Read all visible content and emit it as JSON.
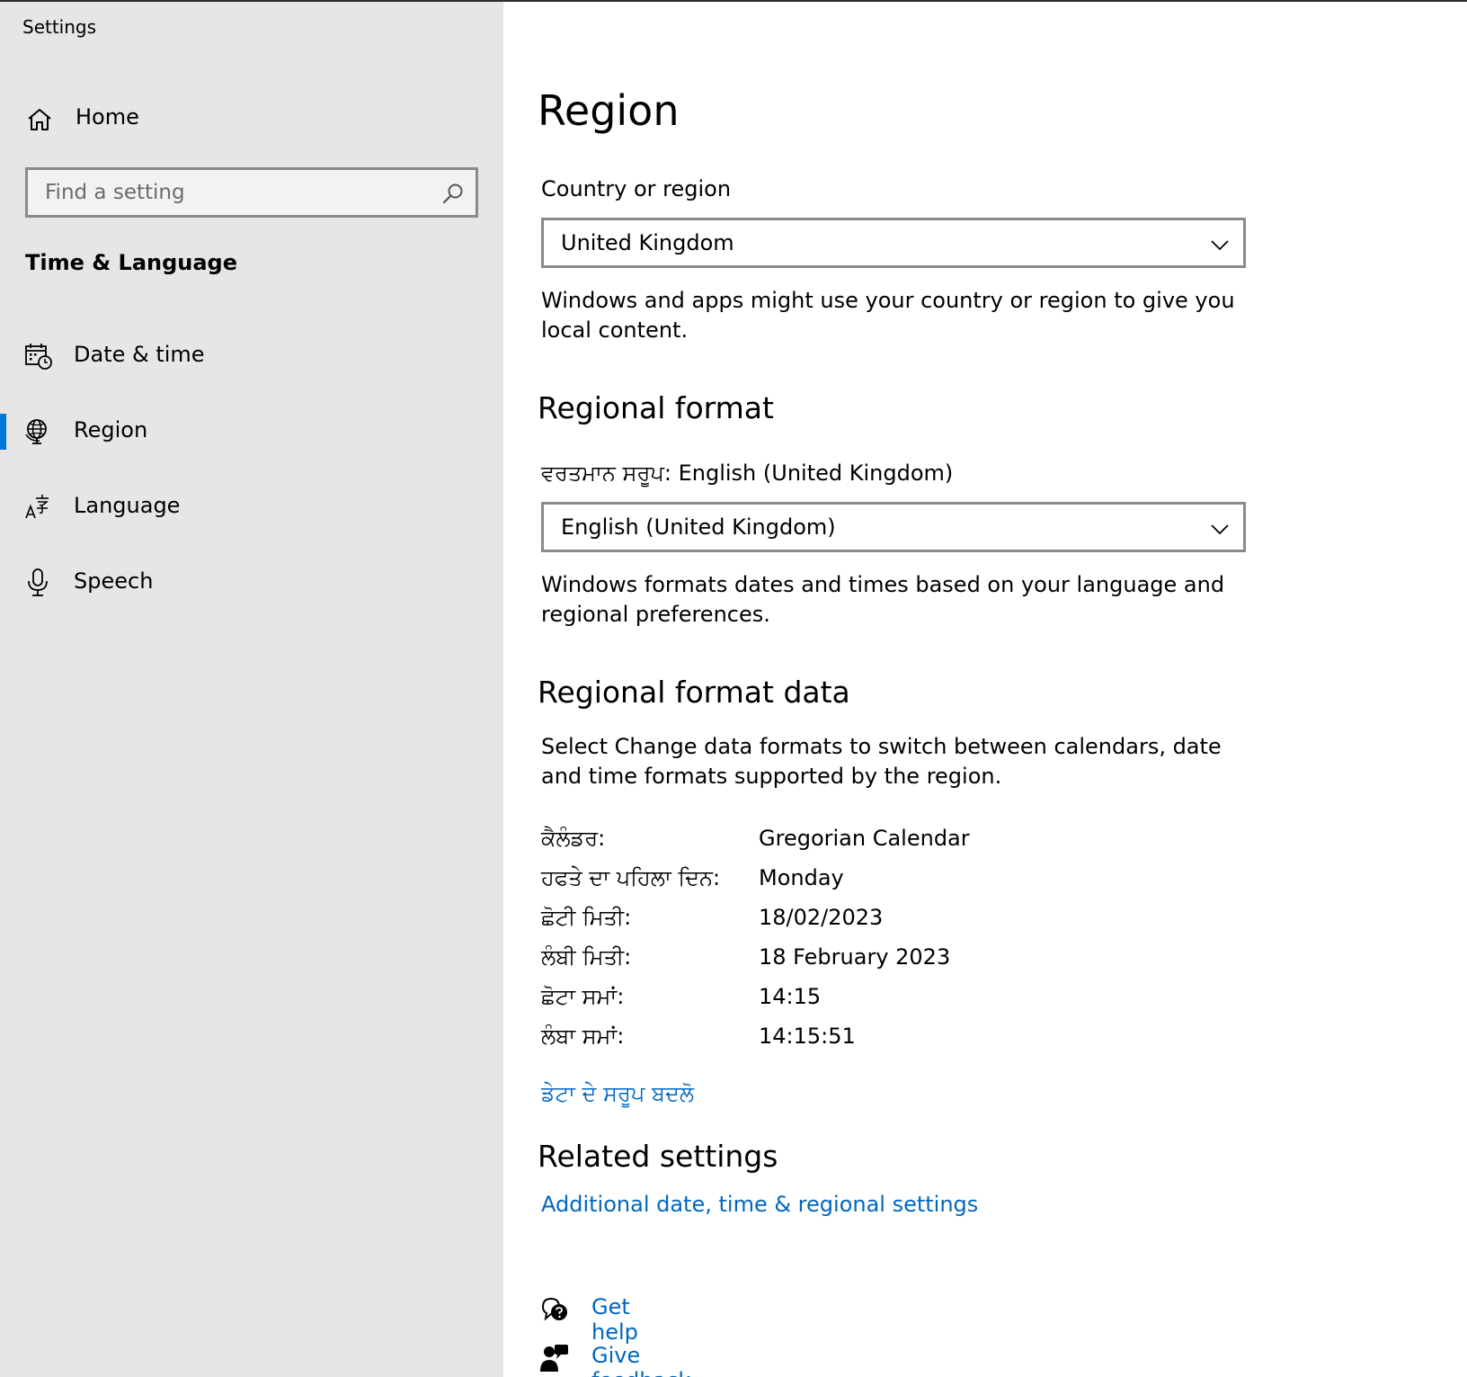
{
  "window": {
    "title": "Settings"
  },
  "sidebar": {
    "home_label": "Home",
    "search": {
      "placeholder": "Find a setting",
      "value": ""
    },
    "section_title": "Time & Language",
    "items": [
      {
        "label": "Date & time",
        "icon": "calendar-clock-icon",
        "active": false
      },
      {
        "label": "Region",
        "icon": "globe-icon",
        "active": true
      },
      {
        "label": "Language",
        "icon": "language-icon",
        "active": false
      },
      {
        "label": "Speech",
        "icon": "microphone-icon",
        "active": false
      }
    ]
  },
  "main": {
    "title": "Region",
    "country": {
      "label": "Country or region",
      "selected": "United Kingdom",
      "description": "Windows and apps might use your country or region to give you local content."
    },
    "regional_format": {
      "title": "Regional format",
      "current_label": "ਵਰਤਮਾਨ ਸਰੂਪ: English (United Kingdom)",
      "selected": "English (United Kingdom)",
      "description": "Windows formats dates and times based on your language and regional preferences."
    },
    "format_data": {
      "title": "Regional format data",
      "description": "Select Change data formats to switch between calendars, date and time formats supported by the region.",
      "rows": [
        {
          "key": "ਕੈਲੰਡਰ:",
          "value": "Gregorian Calendar"
        },
        {
          "key": "ਹਫਤੇ ਦਾ ਪਹਿਲਾ ਦਿਨ:",
          "value": "Monday"
        },
        {
          "key": "ਛੋਟੀ ਮਿਤੀ:",
          "value": "18/02/2023"
        },
        {
          "key": "ਲੰਬੀ ਮਿਤੀ:",
          "value": "18 February 2023"
        },
        {
          "key": "ਛੋਟਾ ਸਮਾਂ:",
          "value": "14:15"
        },
        {
          "key": "ਲੰਬਾ ਸਮਾਂ:",
          "value": "14:15:51"
        }
      ],
      "change_link": "ਡੇਟਾ ਦੇ ਸਰੂਪ ਬਦਲੋ"
    },
    "related": {
      "title": "Related settings",
      "link": "Additional date, time & regional settings"
    },
    "help": {
      "get_help": "Get help",
      "give_feedback": "Give feedback"
    }
  },
  "colors": {
    "accent": "#0078d7",
    "link": "#0067c0",
    "sidebar_bg": "#e6e6e6"
  }
}
